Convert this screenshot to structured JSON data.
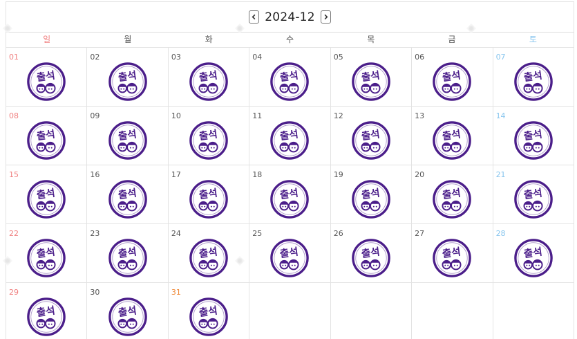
{
  "calendar": {
    "month_label": "2024-12",
    "prev_icon": "chevron-left-icon",
    "next_icon": "chevron-right-icon",
    "stamp_icon": "attendance-stamp-icon",
    "stamp_text": "출석",
    "accent": {
      "stamp": "#4b1e8a",
      "sunday": "#f08080",
      "saturday": "#87c5ee",
      "highlight": "#ef8a3a"
    },
    "weekdays": [
      "일",
      "월",
      "화",
      "수",
      "목",
      "금",
      "토"
    ],
    "weeks": [
      [
        "01",
        "02",
        "03",
        "04",
        "05",
        "06",
        "07"
      ],
      [
        "08",
        "09",
        "10",
        "11",
        "12",
        "13",
        "14"
      ],
      [
        "15",
        "16",
        "17",
        "18",
        "19",
        "20",
        "21"
      ],
      [
        "22",
        "23",
        "24",
        "25",
        "26",
        "27",
        "28"
      ],
      [
        "29",
        "30",
        "31",
        "",
        "",
        "",
        ""
      ]
    ],
    "highlighted_day": "31"
  }
}
